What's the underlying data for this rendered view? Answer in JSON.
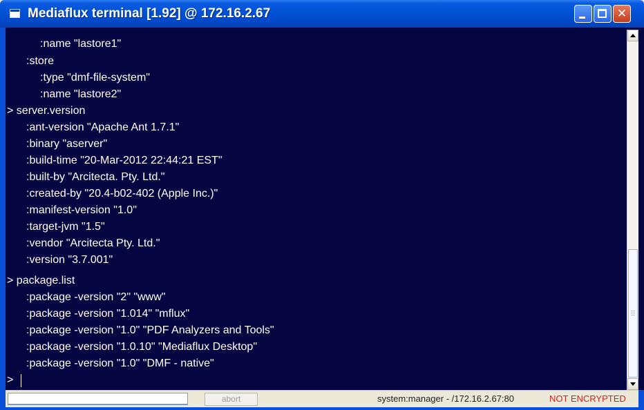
{
  "window": {
    "title": "Mediaflux terminal [1.92] @ 172.16.2.67",
    "minimize_glyph": "",
    "maximize_glyph": "",
    "close_glyph": "✕"
  },
  "terminal": {
    "lines": [
      ":name \"lastore1\"",
      ":store",
      ":type \"dmf-file-system\"",
      ":name \"lastore2\"",
      "> server.version",
      ":ant-version \"Apache Ant 1.7.1\"",
      ":binary \"aserver\"",
      ":build-time \"20-Mar-2012 22:44:21 EST\"",
      ":built-by \"Arcitecta. Pty. Ltd.\"",
      ":created-by \"20.4-b02-402 (Apple Inc.)\"",
      ":manifest-version \"1.0\"",
      ":target-jvm \"1.5\"",
      ":vendor \"Arcitecta Pty. Ltd.\"",
      ":version \"3.7.001\"",
      "> package.list",
      ":package -version \"2\" \"www\"",
      ":package -version \"1.014\" \"mflux\"",
      ":package -version \"1.0\" \"PDF Analyzers and Tools\"",
      ":package -version \"1.0.10\" \"Mediaflux Desktop\"",
      ":package -version \"1.0\" \"DMF - native\"",
      ">"
    ]
  },
  "status": {
    "command_input": "",
    "abort_label": "abort",
    "connection": "system:manager - /172.16.2.67:80",
    "encryption": "NOT ENCRYPTED"
  },
  "colors": {
    "terminal_bg": "#050541",
    "terminal_text": "#ffffff",
    "titlebar": "#0052d6",
    "warning": "#d22020"
  }
}
